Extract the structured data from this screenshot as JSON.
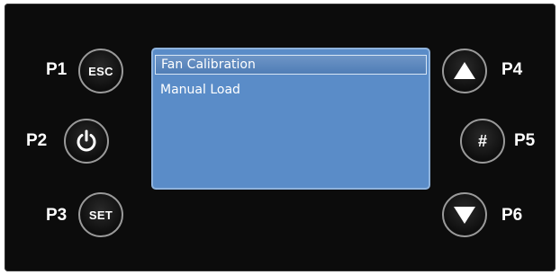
{
  "panel": {
    "background": "#0c0c0c"
  },
  "screen": {
    "background": "#5a8cc8",
    "menu": [
      {
        "label": "Fan Calibration",
        "selected": true
      },
      {
        "label": "Manual Load",
        "selected": false
      }
    ]
  },
  "buttons": {
    "p1": {
      "label": "P1",
      "key": "ESC"
    },
    "p2": {
      "label": "P2",
      "icon": "power-icon"
    },
    "p3": {
      "label": "P3",
      "key": "SET"
    },
    "p4": {
      "label": "P4",
      "icon": "up-arrow-icon"
    },
    "p5": {
      "label": "P5",
      "key": "#"
    },
    "p6": {
      "label": "P6",
      "icon": "down-arrow-icon"
    }
  }
}
